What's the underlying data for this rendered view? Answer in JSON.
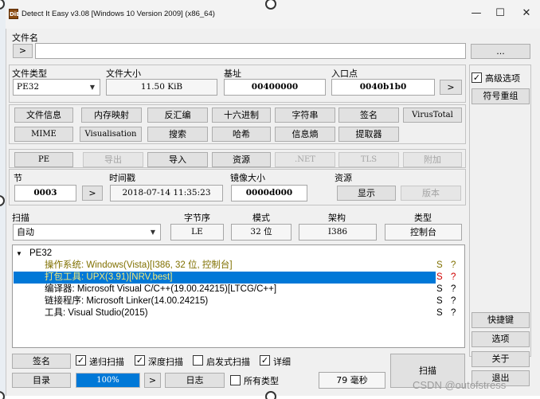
{
  "window": {
    "title": "Detect It Easy v3.08 [Windows 10 Version 2009] (x86_64)",
    "icon_text": "DiE",
    "controls": {
      "minimize": "—",
      "maximize": "☐",
      "close": "✕"
    }
  },
  "file": {
    "label": "文件名",
    "browse_arrow": ">",
    "path_value": "",
    "more_button": "..."
  },
  "info": {
    "file_type_label": "文件类型",
    "file_type_value": "PE32",
    "file_size_label": "文件大小",
    "file_size_value": "11.50 KiB",
    "base_label": "基址",
    "base_value": "00400000",
    "entry_label": "入口点",
    "entry_value": "0040b1b0",
    "entry_arrow": ">"
  },
  "options": {
    "advanced_label": "高级选项",
    "advanced_checked": true,
    "symbol_reorg": "符号重组"
  },
  "tools_row1": [
    "文件信息",
    "内存映射",
    "反汇编",
    "十六进制",
    "字符串",
    "签名",
    "VirusTotal"
  ],
  "tools_row2": [
    "MIME",
    "Visualisation",
    "搜索",
    "哈希",
    "信息熵",
    "提取器"
  ],
  "pe_row": {
    "pe": "PE",
    "export": "导出",
    "import": "导入",
    "resources": "资源",
    "net": ".NET",
    "tls": "TLS",
    "overlay": "附加"
  },
  "section": {
    "section_label": "节",
    "section_value": "0003",
    "section_arrow": ">",
    "timestamp_label": "时间戳",
    "timestamp_value": "2018-07-14 11:35:23",
    "image_size_label": "镜像大小",
    "image_size_value": "0000d000",
    "resources_label": "资源",
    "show_button": "显示",
    "version_button": "版本"
  },
  "scan": {
    "scan_label": "扫描",
    "scan_mode": "自动",
    "endian_label": "字节序",
    "endian_value": "LE",
    "mode_label": "模式",
    "mode_value": "32 位",
    "arch_label": "架构",
    "arch_value": "I386",
    "type_label": "类型",
    "type_value": "控制台"
  },
  "results": {
    "root": "PE32",
    "rows": [
      {
        "text": "操作系统: Windows(Vista)[I386, 32 位, 控制台]",
        "s": "S",
        "q": "?"
      },
      {
        "text": "打包工具: UPX(3.91)[NRV,best]",
        "s": "S",
        "q": "?"
      },
      {
        "text": "编译器: Microsoft Visual C/C++(19.00.24215)[LTCG/C++]",
        "s": "S",
        "q": "?"
      },
      {
        "text": "链接程序: Microsoft Linker(14.00.24215)",
        "s": "S",
        "q": "?"
      },
      {
        "text": "工具: Visual Studio(2015)",
        "s": "S",
        "q": "?"
      }
    ]
  },
  "side_buttons": {
    "shortcuts": "快捷键",
    "options": "选项",
    "about": "关于",
    "exit": "退出"
  },
  "bottom": {
    "signature": "签名",
    "recursive": "递归扫描",
    "recursive_checked": true,
    "deep": "深度扫描",
    "deep_checked": true,
    "heuristic": "启发式扫描",
    "heuristic_checked": false,
    "verbose": "详细",
    "verbose_checked": true,
    "directory": "目录",
    "progress": "100%",
    "progress_fraction": 1.0,
    "arrow": ">",
    "log": "日志",
    "all_types": "所有类型",
    "all_types_checked": false,
    "time": "79 毫秒",
    "scan_button": "扫描"
  },
  "watermark": "CSDN @outofstress",
  "colors": {
    "selection": "#0078d7",
    "olive": "#807000",
    "red": "#d00000",
    "progress": "#06b025"
  }
}
